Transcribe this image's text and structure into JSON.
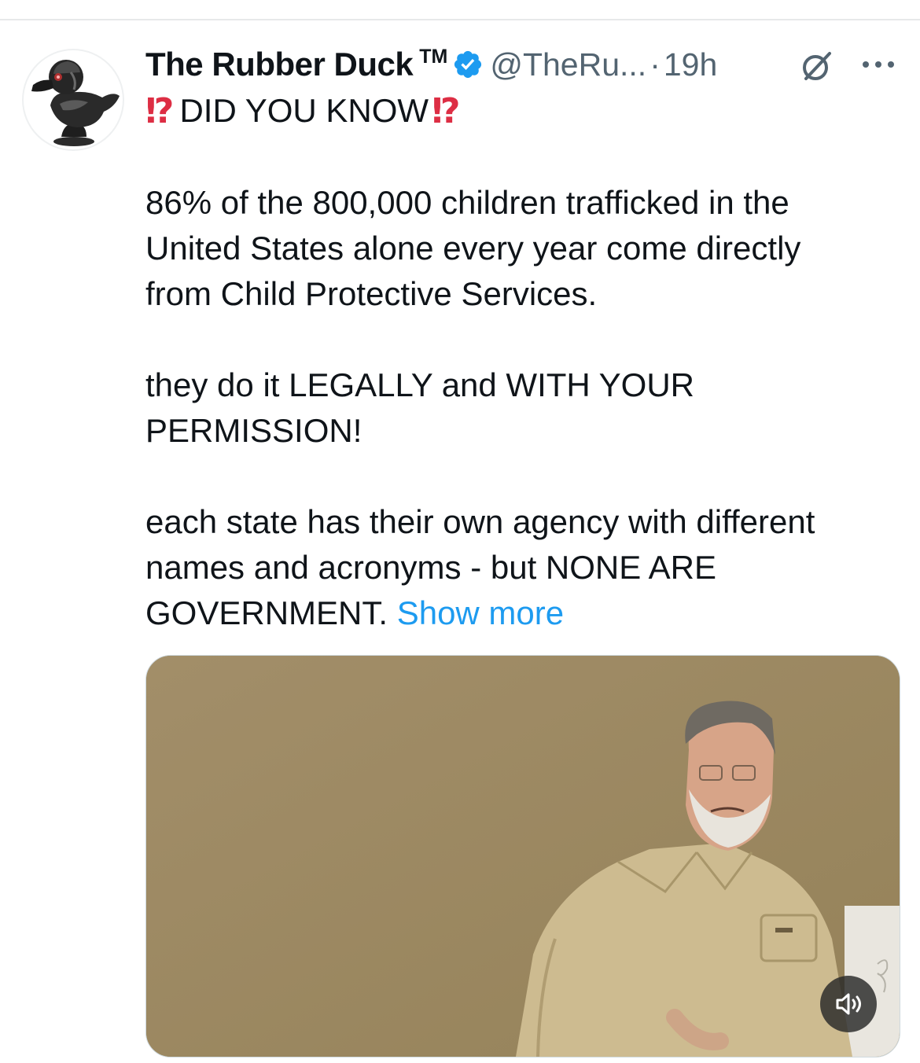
{
  "tweet": {
    "author": {
      "display_name": "The Rubber Duck",
      "trademark": "TM",
      "handle": "@TheRu...",
      "verified": true,
      "avatar_icon": "rubber-duck-avatar"
    },
    "separator": "·",
    "timestamp": "19h",
    "header_icons": [
      "grok-icon",
      "more-icon"
    ],
    "headline": {
      "left_emoji": "⁉",
      "text": "DID YOU KNOW",
      "right_emoji": "⁉"
    },
    "body": {
      "paragraph_1": [
        "86% of the 800,000 children trafficked in the",
        "United States alone every year come directly",
        "from Child Protective Services."
      ],
      "paragraph_2": [
        "they do it LEGALLY and WITH YOUR",
        "PERMISSION!"
      ],
      "paragraph_3": [
        "each state has their own agency with different",
        "names and acronyms - but NONE ARE",
        "GOVERNMENT."
      ],
      "show_more_label": "Show more"
    },
    "media": {
      "type": "video",
      "mute_icon": "volume-icon"
    }
  },
  "colors": {
    "text_primary": "#0f1419",
    "text_secondary": "#536471",
    "link": "#1d9bf0",
    "verified_badge": "#1d9bf0",
    "emoji_red": "#dd2e44"
  }
}
